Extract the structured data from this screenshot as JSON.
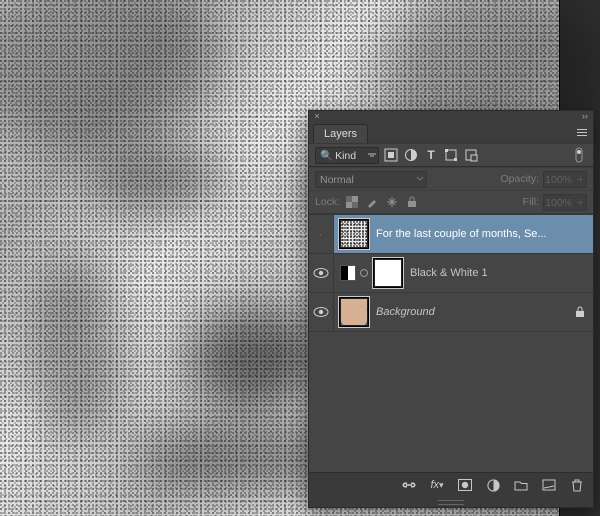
{
  "panel": {
    "title": "Layers",
    "filter": {
      "kind": "Kind"
    },
    "blend": {
      "mode": "Normal",
      "opacity_label": "Opacity:",
      "opacity_value": "100%"
    },
    "lock": {
      "label": "Lock:",
      "fill_label": "Fill:",
      "fill_value": "100%"
    },
    "layers": [
      {
        "name": "For the last couple of months, Se...",
        "visible": false,
        "selected": true,
        "thumb": "noise",
        "locked": false,
        "has_adjustment_badge": false,
        "has_mask": false
      },
      {
        "name": "Black & White 1",
        "visible": true,
        "selected": false,
        "thumb": "mask",
        "locked": false,
        "has_adjustment_badge": true,
        "has_mask": true
      },
      {
        "name": "Background",
        "visible": true,
        "selected": false,
        "thumb": "face",
        "locked": true,
        "has_adjustment_badge": false,
        "has_mask": false
      }
    ],
    "footer_icon_names": [
      "link-icon",
      "fx-icon",
      "mask-icon",
      "adjustment-icon",
      "group-icon",
      "new-layer-icon",
      "trash-icon"
    ]
  }
}
